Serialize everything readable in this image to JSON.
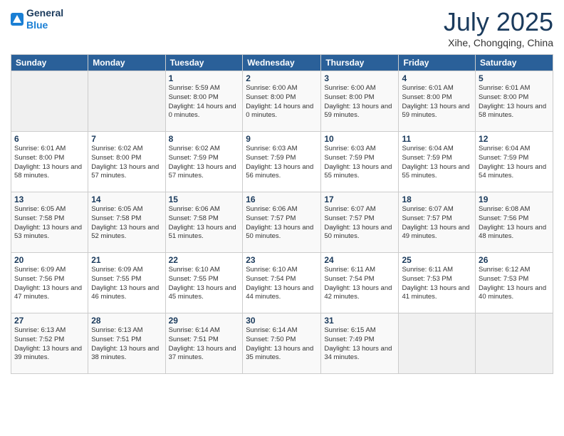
{
  "header": {
    "logo_general": "General",
    "logo_blue": "Blue",
    "month_title": "July 2025",
    "location": "Xihe, Chongqing, China"
  },
  "days_of_week": [
    "Sunday",
    "Monday",
    "Tuesday",
    "Wednesday",
    "Thursday",
    "Friday",
    "Saturday"
  ],
  "weeks": [
    [
      {
        "num": "",
        "sunrise": "",
        "sunset": "",
        "daylight": ""
      },
      {
        "num": "",
        "sunrise": "",
        "sunset": "",
        "daylight": ""
      },
      {
        "num": "1",
        "sunrise": "Sunrise: 5:59 AM",
        "sunset": "Sunset: 8:00 PM",
        "daylight": "Daylight: 14 hours and 0 minutes."
      },
      {
        "num": "2",
        "sunrise": "Sunrise: 6:00 AM",
        "sunset": "Sunset: 8:00 PM",
        "daylight": "Daylight: 14 hours and 0 minutes."
      },
      {
        "num": "3",
        "sunrise": "Sunrise: 6:00 AM",
        "sunset": "Sunset: 8:00 PM",
        "daylight": "Daylight: 13 hours and 59 minutes."
      },
      {
        "num": "4",
        "sunrise": "Sunrise: 6:01 AM",
        "sunset": "Sunset: 8:00 PM",
        "daylight": "Daylight: 13 hours and 59 minutes."
      },
      {
        "num": "5",
        "sunrise": "Sunrise: 6:01 AM",
        "sunset": "Sunset: 8:00 PM",
        "daylight": "Daylight: 13 hours and 58 minutes."
      }
    ],
    [
      {
        "num": "6",
        "sunrise": "Sunrise: 6:01 AM",
        "sunset": "Sunset: 8:00 PM",
        "daylight": "Daylight: 13 hours and 58 minutes."
      },
      {
        "num": "7",
        "sunrise": "Sunrise: 6:02 AM",
        "sunset": "Sunset: 8:00 PM",
        "daylight": "Daylight: 13 hours and 57 minutes."
      },
      {
        "num": "8",
        "sunrise": "Sunrise: 6:02 AM",
        "sunset": "Sunset: 7:59 PM",
        "daylight": "Daylight: 13 hours and 57 minutes."
      },
      {
        "num": "9",
        "sunrise": "Sunrise: 6:03 AM",
        "sunset": "Sunset: 7:59 PM",
        "daylight": "Daylight: 13 hours and 56 minutes."
      },
      {
        "num": "10",
        "sunrise": "Sunrise: 6:03 AM",
        "sunset": "Sunset: 7:59 PM",
        "daylight": "Daylight: 13 hours and 55 minutes."
      },
      {
        "num": "11",
        "sunrise": "Sunrise: 6:04 AM",
        "sunset": "Sunset: 7:59 PM",
        "daylight": "Daylight: 13 hours and 55 minutes."
      },
      {
        "num": "12",
        "sunrise": "Sunrise: 6:04 AM",
        "sunset": "Sunset: 7:59 PM",
        "daylight": "Daylight: 13 hours and 54 minutes."
      }
    ],
    [
      {
        "num": "13",
        "sunrise": "Sunrise: 6:05 AM",
        "sunset": "Sunset: 7:58 PM",
        "daylight": "Daylight: 13 hours and 53 minutes."
      },
      {
        "num": "14",
        "sunrise": "Sunrise: 6:05 AM",
        "sunset": "Sunset: 7:58 PM",
        "daylight": "Daylight: 13 hours and 52 minutes."
      },
      {
        "num": "15",
        "sunrise": "Sunrise: 6:06 AM",
        "sunset": "Sunset: 7:58 PM",
        "daylight": "Daylight: 13 hours and 51 minutes."
      },
      {
        "num": "16",
        "sunrise": "Sunrise: 6:06 AM",
        "sunset": "Sunset: 7:57 PM",
        "daylight": "Daylight: 13 hours and 50 minutes."
      },
      {
        "num": "17",
        "sunrise": "Sunrise: 6:07 AM",
        "sunset": "Sunset: 7:57 PM",
        "daylight": "Daylight: 13 hours and 50 minutes."
      },
      {
        "num": "18",
        "sunrise": "Sunrise: 6:07 AM",
        "sunset": "Sunset: 7:57 PM",
        "daylight": "Daylight: 13 hours and 49 minutes."
      },
      {
        "num": "19",
        "sunrise": "Sunrise: 6:08 AM",
        "sunset": "Sunset: 7:56 PM",
        "daylight": "Daylight: 13 hours and 48 minutes."
      }
    ],
    [
      {
        "num": "20",
        "sunrise": "Sunrise: 6:09 AM",
        "sunset": "Sunset: 7:56 PM",
        "daylight": "Daylight: 13 hours and 47 minutes."
      },
      {
        "num": "21",
        "sunrise": "Sunrise: 6:09 AM",
        "sunset": "Sunset: 7:55 PM",
        "daylight": "Daylight: 13 hours and 46 minutes."
      },
      {
        "num": "22",
        "sunrise": "Sunrise: 6:10 AM",
        "sunset": "Sunset: 7:55 PM",
        "daylight": "Daylight: 13 hours and 45 minutes."
      },
      {
        "num": "23",
        "sunrise": "Sunrise: 6:10 AM",
        "sunset": "Sunset: 7:54 PM",
        "daylight": "Daylight: 13 hours and 44 minutes."
      },
      {
        "num": "24",
        "sunrise": "Sunrise: 6:11 AM",
        "sunset": "Sunset: 7:54 PM",
        "daylight": "Daylight: 13 hours and 42 minutes."
      },
      {
        "num": "25",
        "sunrise": "Sunrise: 6:11 AM",
        "sunset": "Sunset: 7:53 PM",
        "daylight": "Daylight: 13 hours and 41 minutes."
      },
      {
        "num": "26",
        "sunrise": "Sunrise: 6:12 AM",
        "sunset": "Sunset: 7:53 PM",
        "daylight": "Daylight: 13 hours and 40 minutes."
      }
    ],
    [
      {
        "num": "27",
        "sunrise": "Sunrise: 6:13 AM",
        "sunset": "Sunset: 7:52 PM",
        "daylight": "Daylight: 13 hours and 39 minutes."
      },
      {
        "num": "28",
        "sunrise": "Sunrise: 6:13 AM",
        "sunset": "Sunset: 7:51 PM",
        "daylight": "Daylight: 13 hours and 38 minutes."
      },
      {
        "num": "29",
        "sunrise": "Sunrise: 6:14 AM",
        "sunset": "Sunset: 7:51 PM",
        "daylight": "Daylight: 13 hours and 37 minutes."
      },
      {
        "num": "30",
        "sunrise": "Sunrise: 6:14 AM",
        "sunset": "Sunset: 7:50 PM",
        "daylight": "Daylight: 13 hours and 35 minutes."
      },
      {
        "num": "31",
        "sunrise": "Sunrise: 6:15 AM",
        "sunset": "Sunset: 7:49 PM",
        "daylight": "Daylight: 13 hours and 34 minutes."
      },
      {
        "num": "",
        "sunrise": "",
        "sunset": "",
        "daylight": ""
      },
      {
        "num": "",
        "sunrise": "",
        "sunset": "",
        "daylight": ""
      }
    ]
  ]
}
